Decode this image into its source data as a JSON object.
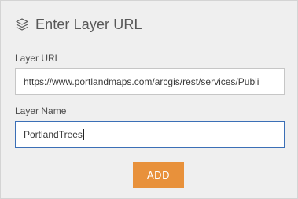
{
  "dialog": {
    "title": "Enter Layer URL",
    "title_icon": "layers-icon"
  },
  "fields": {
    "layer_url": {
      "label": "Layer URL",
      "value": "https://www.portlandmaps.com/arcgis/rest/services/Publi"
    },
    "layer_name": {
      "label": "Layer Name",
      "value": "PortlandTrees"
    }
  },
  "actions": {
    "add_label": "ADD"
  },
  "colors": {
    "accent": "#e8913b",
    "focus_border": "#3b6fb6",
    "panel_background": "#efefef"
  }
}
